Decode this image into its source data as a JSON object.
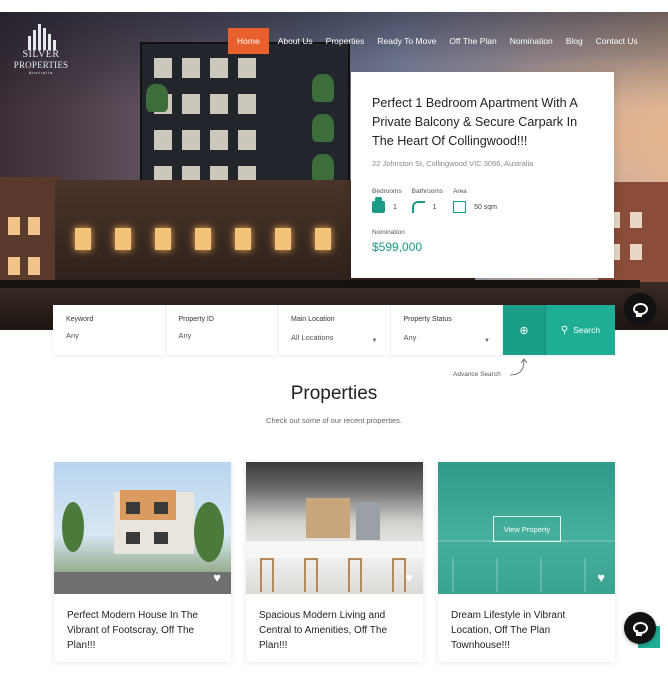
{
  "brand": {
    "line1": "SILVER",
    "line2": "PROPERTIES",
    "line3": "Australia",
    "icon": "city-skyline-logo"
  },
  "nav": {
    "items": [
      {
        "label": "Home",
        "active": true
      },
      {
        "label": "About Us",
        "active": false
      },
      {
        "label": "Properties",
        "active": false
      },
      {
        "label": "Ready To Move",
        "active": false
      },
      {
        "label": "Off The Plan",
        "active": false
      },
      {
        "label": "Nomination",
        "active": false
      },
      {
        "label": "Blog",
        "active": false
      },
      {
        "label": "Contact Us",
        "active": false
      }
    ]
  },
  "featured": {
    "title": "Perfect 1 Bedroom Apartment With A Private Balcony & Secure Carpark In The Heart Of Collingwood!!!",
    "address": "22 Johnston St, Collingwood VIC 3066, Australia",
    "attributes": [
      {
        "label": "Bedrooms",
        "value": "1",
        "icon": "bed-icon"
      },
      {
        "label": "Bathrooms",
        "value": "1",
        "icon": "shower-icon"
      },
      {
        "label": "Area",
        "value": "50 sqm",
        "icon": "area-icon"
      }
    ],
    "nomination_label": "Nomination",
    "price": "$599,000"
  },
  "search": {
    "fields": [
      {
        "label": "Keyword",
        "value": "Any",
        "dropdown": false
      },
      {
        "label": "Property ID",
        "value": "Any",
        "dropdown": false
      },
      {
        "label": "Main Location",
        "value": "All Locations",
        "dropdown": true
      },
      {
        "label": "Property Status",
        "value": "Any",
        "dropdown": true
      }
    ],
    "advanced_icon": "zoom-in-icon",
    "search_label": "Search",
    "advance_search_label": "Advance Search"
  },
  "section": {
    "title": "Properties",
    "subtitle": "Check out some of our recent properties."
  },
  "cards": [
    {
      "title": "Perfect Modern House In The Vibrant of Footscray, Off The Plan!!!"
    },
    {
      "title": "Spacious Modern Living and Central to Amenities, Off The Plan!!!"
    },
    {
      "title": "Dream Lifestyle in Vibrant Location, Off The Plan Townhouse!!!",
      "hover_button": "View Property"
    }
  ],
  "colors": {
    "accent": "#1fae95",
    "nav_active": "#e8602c",
    "price": "#1b9b87"
  }
}
